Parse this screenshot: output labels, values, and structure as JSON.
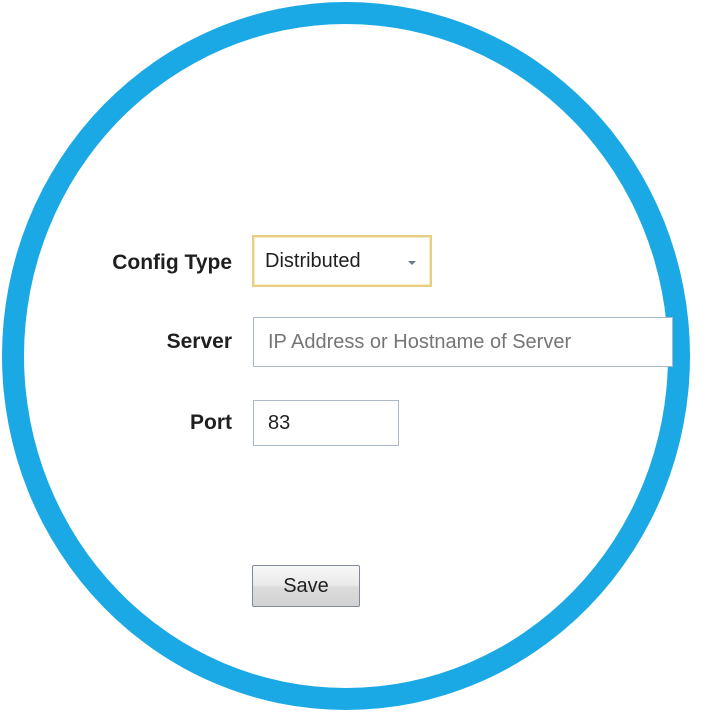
{
  "form": {
    "config_type": {
      "label": "Config Type",
      "selected": "Distributed"
    },
    "server": {
      "label": "Server",
      "value": "",
      "placeholder": "IP Address or Hostname of Server"
    },
    "port": {
      "label": "Port",
      "value": "83"
    },
    "save_label": "Save"
  },
  "colors": {
    "ring": "#1aa9e4",
    "combo_focus_border": "#e6cf82",
    "textbox_border": "#aab7c6"
  }
}
